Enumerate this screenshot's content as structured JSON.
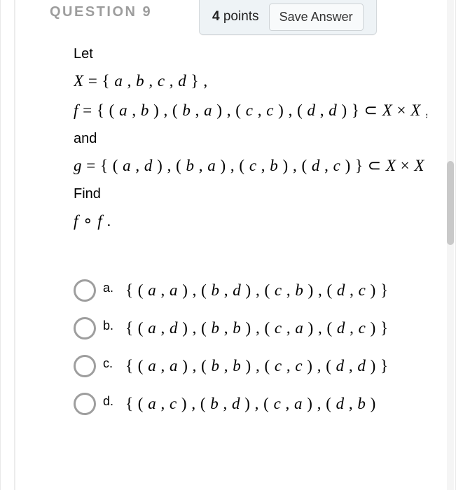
{
  "header": {
    "question_label": "QUESTION 9",
    "points_value": "4",
    "points_word": "points",
    "save_label": "Save Answer"
  },
  "prompt": {
    "let_label": "Let",
    "x_def": "X = { a , b , c , d } ,",
    "f_def": "f = { ( a , b ) , ( b , a ) , ( c , c ) , ( d , d ) } ⊂ X × X ,",
    "and_label": "and",
    "g_def": "g = { ( a , d ) , ( b , a ) , ( c , b ) , ( d , c ) } ⊂ X × X .",
    "find_label": "Find",
    "fof": "f ∘ f ."
  },
  "options": {
    "items": [
      {
        "letter": "a.",
        "text": "{ ( a , a ) , ( b , d ) , ( c , b ) , ( d , c ) }"
      },
      {
        "letter": "b.",
        "text": "{ ( a , d ) , ( b , b ) , ( c , a ) , ( d , c ) }"
      },
      {
        "letter": "c.",
        "text": "{ ( a , a ) , ( b , b ) , ( c , c ) , ( d , d ) }"
      },
      {
        "letter": "d.",
        "text": "{ ( a , c ) , ( b , d ) , ( c , a ) , ( d , b )"
      }
    ]
  }
}
